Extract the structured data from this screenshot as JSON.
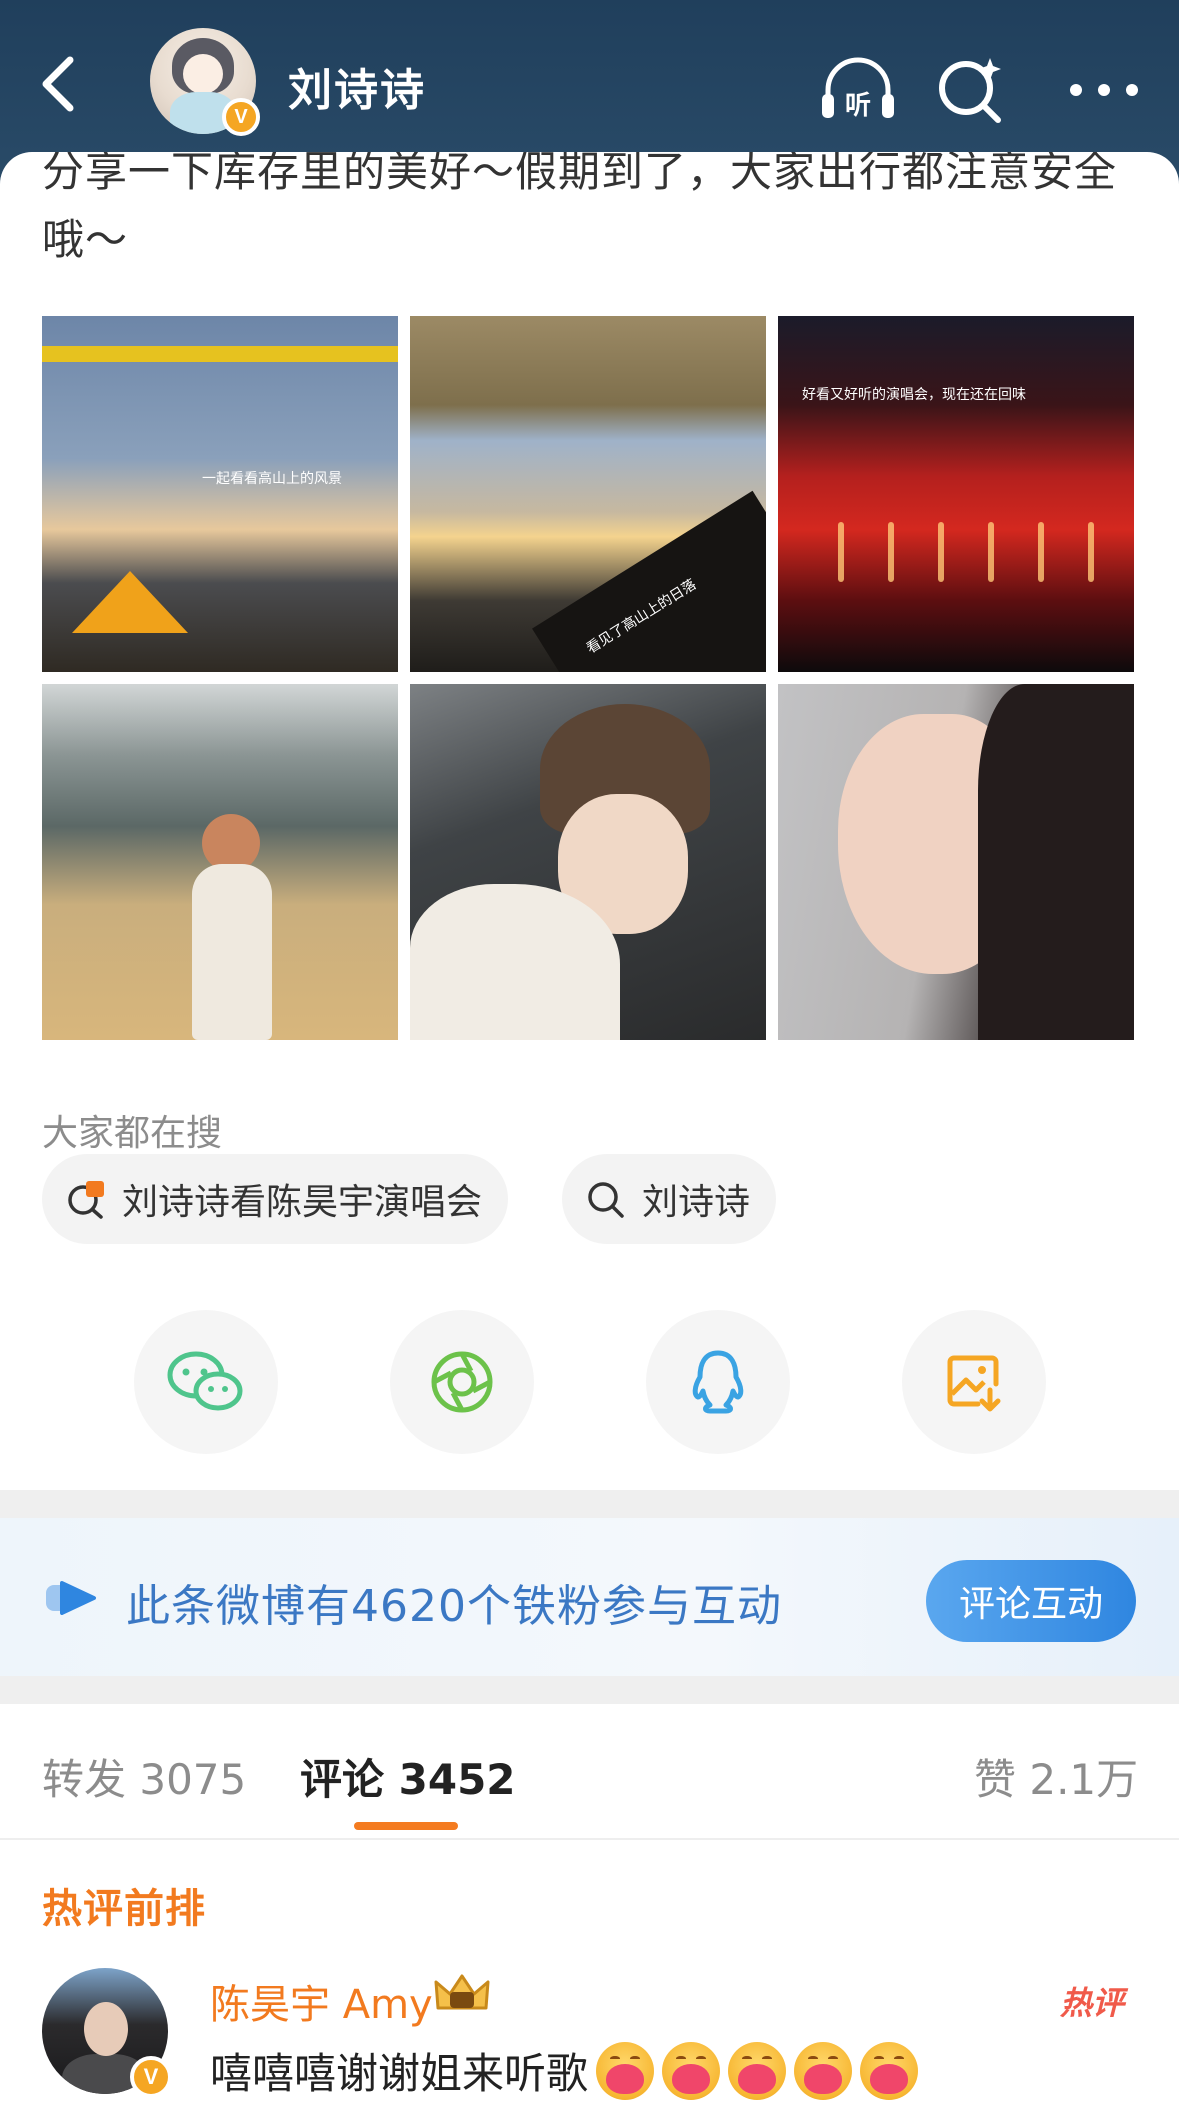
{
  "header": {
    "user_name": "刘诗诗",
    "verified_badge": "V",
    "icons": [
      "back-icon",
      "listen-icon",
      "search-sparkle-icon",
      "more-icon"
    ],
    "listen_label": "听"
  },
  "post": {
    "text": "分享一下库存里的美好～假期到了，大家出行都注意安全哦～",
    "photos": [
      {
        "caption": "一起看看高山上的风景"
      },
      {
        "caption": "看见了高山上的日落"
      },
      {
        "caption": "好看又好听的演唱会，现在还在回味"
      },
      {
        "caption": ""
      },
      {
        "caption": ""
      },
      {
        "caption": ""
      }
    ]
  },
  "search": {
    "title": "大家都在搜",
    "chips": [
      {
        "label": "刘诗诗看陈昊宇演唱会",
        "icon": "hot-search-icon"
      },
      {
        "label": "刘诗诗",
        "icon": "search-icon"
      }
    ]
  },
  "share": {
    "buttons": [
      "wechat-icon",
      "moments-icon",
      "qq-icon",
      "save-image-icon"
    ]
  },
  "fan_banner": {
    "text": "此条微博有4620个铁粉参与互动",
    "button_label": "评论互动"
  },
  "tabs": {
    "repost": "转发 3075",
    "comments": "评论 3452",
    "likes": "赞 2.1万"
  },
  "comments": {
    "section_title": "热评前排",
    "items": [
      {
        "author": "陈昊宇 Amy",
        "text": "嘻嘻嘻谢谢姐来听歌",
        "emoji_count": 5,
        "tag": "热评",
        "verified_badge": "V"
      }
    ]
  },
  "colors": {
    "header_bg": "#203f5c",
    "accent_orange": "#f27a1f",
    "link_blue": "#3b78c4",
    "wechat_green": "#4fc58c",
    "qq_blue": "#3aa3e3",
    "save_yellow": "#f5a623"
  }
}
